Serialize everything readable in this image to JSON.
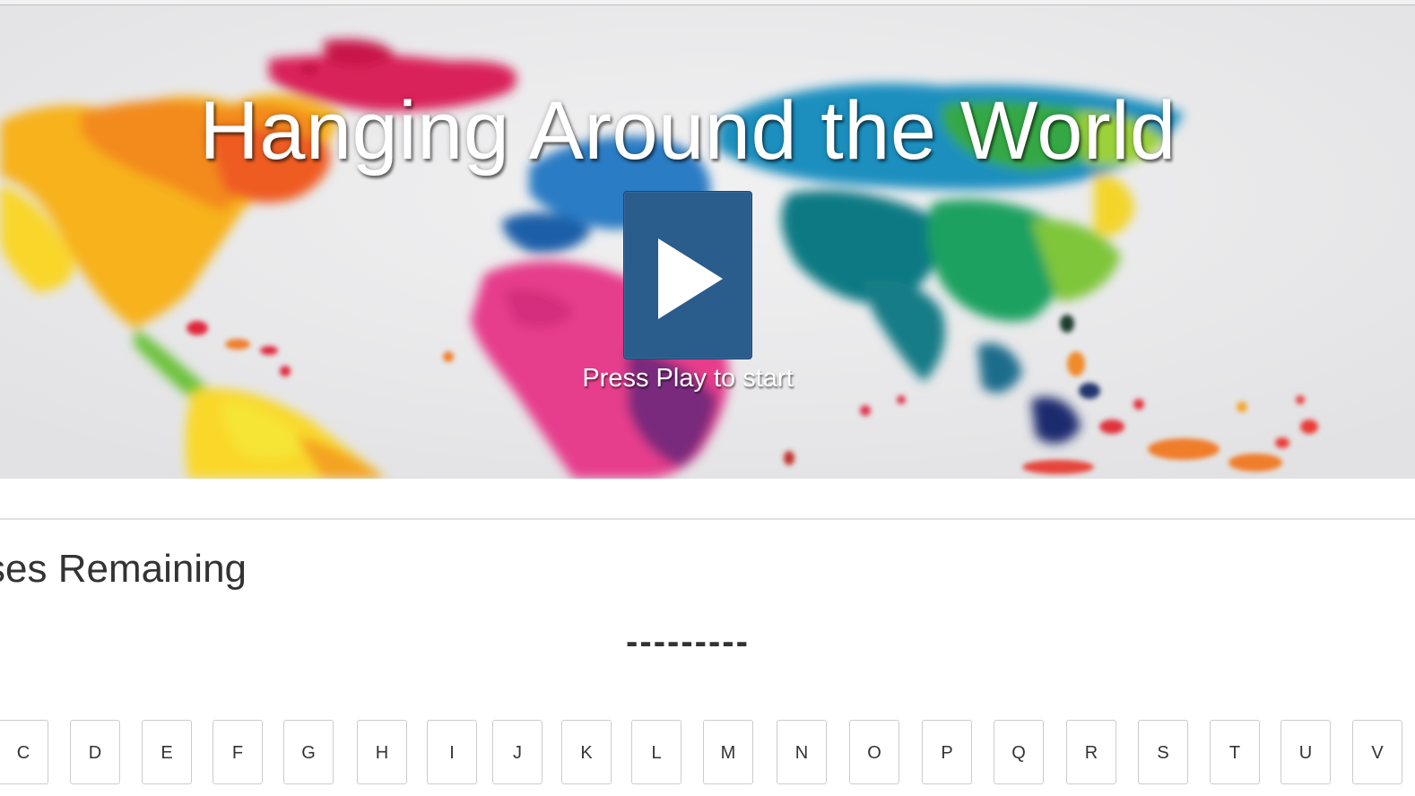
{
  "hero": {
    "title": "Hanging Around the World",
    "play_hint": "Press Play to start"
  },
  "status": {
    "guesses_label": "ses Remaining"
  },
  "word": {
    "blanks": "---------"
  },
  "keyboard": {
    "keys": [
      "C",
      "D",
      "E",
      "F",
      "G",
      "H",
      "I",
      "J",
      "K",
      "L",
      "M",
      "N",
      "O",
      "P",
      "Q",
      "R",
      "S",
      "T",
      "U",
      "V"
    ]
  },
  "colors": {
    "play_button": "#2a5c8c",
    "text": "#333333",
    "key_border": "#cccccc"
  }
}
